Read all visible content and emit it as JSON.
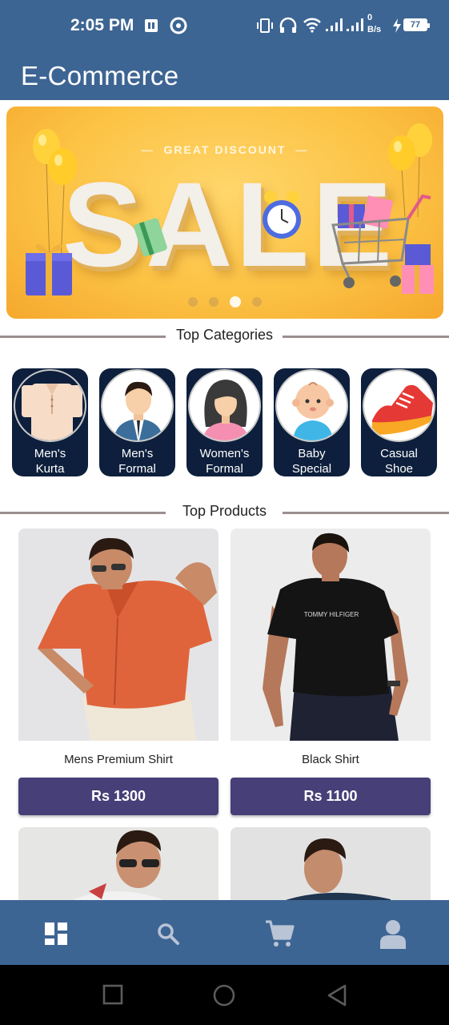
{
  "status_bar": {
    "time": "2:05 PM",
    "net_speed_value": "0",
    "net_speed_unit": "B/s",
    "battery": "77"
  },
  "app_bar": {
    "title": "E-Commerce"
  },
  "banner": {
    "subtitle": "GREAT DISCOUNT",
    "headline": "SALE",
    "slide_count": 4,
    "active_slide": 3
  },
  "categories": {
    "heading": "Top Categories",
    "items": [
      {
        "line1": "Men's",
        "line2": "Kurta"
      },
      {
        "line1": "Men's",
        "line2": "Formal"
      },
      {
        "line1": "Women's",
        "line2": "Formal"
      },
      {
        "line1": "Baby",
        "line2": "Special"
      },
      {
        "line1": "Casual",
        "line2": "Shoe"
      }
    ]
  },
  "products": {
    "heading": "Top Products",
    "items": [
      {
        "name": "Mens Premium Shirt",
        "price": "Rs 1300"
      },
      {
        "name": "Black Shirt",
        "price": "Rs 1100"
      }
    ]
  },
  "bottom_nav": {
    "items": [
      "dashboard-icon",
      "search-icon",
      "cart-icon",
      "profile-icon"
    ]
  },
  "colors": {
    "primary": "#3d6593",
    "price_button": "#473f78",
    "category_card": "#0d1f3c",
    "banner": "#fcc345"
  }
}
